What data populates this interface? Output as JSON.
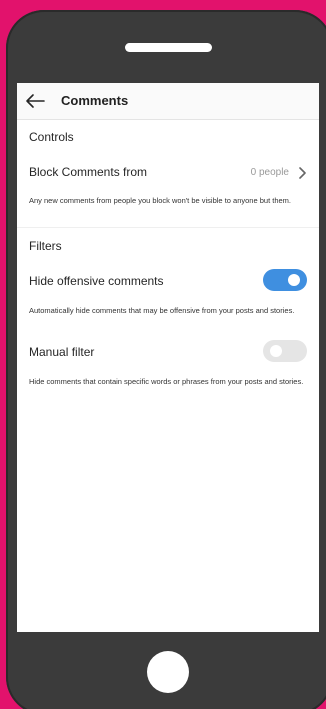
{
  "header": {
    "title": "Comments"
  },
  "sections": {
    "controls": {
      "title": "Controls",
      "block": {
        "label": "Block Comments from",
        "value": "0 people",
        "description": "Any new comments from people you block won't be visible to anyone but them."
      }
    },
    "filters": {
      "title": "Filters",
      "hide_offensive": {
        "label": "Hide offensive comments",
        "enabled": true,
        "description": "Automatically hide comments that may be offensive from your posts and stories."
      },
      "manual_filter": {
        "label": "Manual filter",
        "enabled": false,
        "description": "Hide comments that contain specific words or phrases from your posts and stories."
      }
    }
  },
  "colors": {
    "background": "#e2126c",
    "device": "#3b3b3b",
    "toggle_on": "#3f8fe0",
    "toggle_off": "#e5e5e5"
  },
  "icons": {
    "back": "arrow-left-icon",
    "chevron": "chevron-right-icon"
  }
}
